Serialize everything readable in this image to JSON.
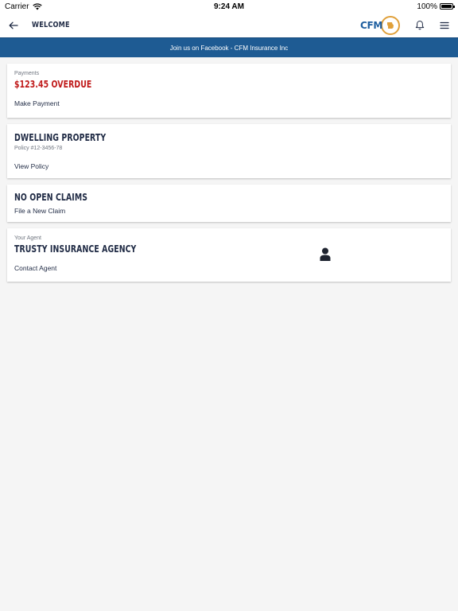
{
  "status_bar": {
    "carrier": "Carrier",
    "time": "9:24 AM",
    "battery": "100%"
  },
  "nav": {
    "title": "WELCOME",
    "logo_text": "CFM",
    "icons": [
      "back-arrow-icon",
      "logo",
      "bell-icon",
      "menu-icon"
    ]
  },
  "banner": {
    "text": "Join us on Facebook - CFM Insurance Inc"
  },
  "payments": {
    "label": "Payments",
    "amount": "$123.45 OVERDUE",
    "link": "Make Payment"
  },
  "policy": {
    "title": "DWELLING PROPERTY",
    "number": "Policy #12-3456-78",
    "link": "View Policy"
  },
  "claims": {
    "title": "NO OPEN CLAIMS",
    "link": "File a New Claim"
  },
  "agent": {
    "label": "Your Agent",
    "name": "TRUSTY INSURANCE AGENCY",
    "link": "Contact Agent"
  },
  "colors": {
    "banner": "#1e5b93",
    "overdue": "#c01a1a",
    "text_dark": "#1f2a44",
    "logo_blue": "#1f5fa0",
    "logo_gold": "#e0a03a",
    "background": "#f5f5f5"
  }
}
